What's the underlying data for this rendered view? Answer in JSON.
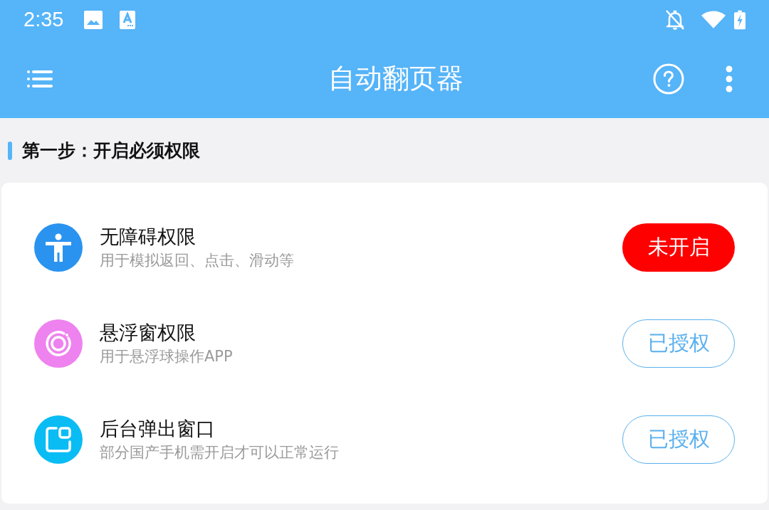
{
  "status_bar": {
    "time": "2:35"
  },
  "app_bar": {
    "title": "自动翻页器"
  },
  "section": {
    "title": "第一步：开启必须权限"
  },
  "permissions": [
    {
      "kind": "accessibility",
      "color": "#2a93f0",
      "title": "无障碍权限",
      "description": "用于模拟返回、点击、滑动等",
      "status": "未开启",
      "granted": false
    },
    {
      "kind": "floating",
      "color": "#ee82ee",
      "title": "悬浮窗权限",
      "description": "用于悬浮球操作APP",
      "status": "已授权",
      "granted": true
    },
    {
      "kind": "popup",
      "color": "#0abcf4",
      "title": "后台弹出窗口",
      "description": "部分国产手机需开启才可以正常运行",
      "status": "已授权",
      "granted": true
    }
  ]
}
